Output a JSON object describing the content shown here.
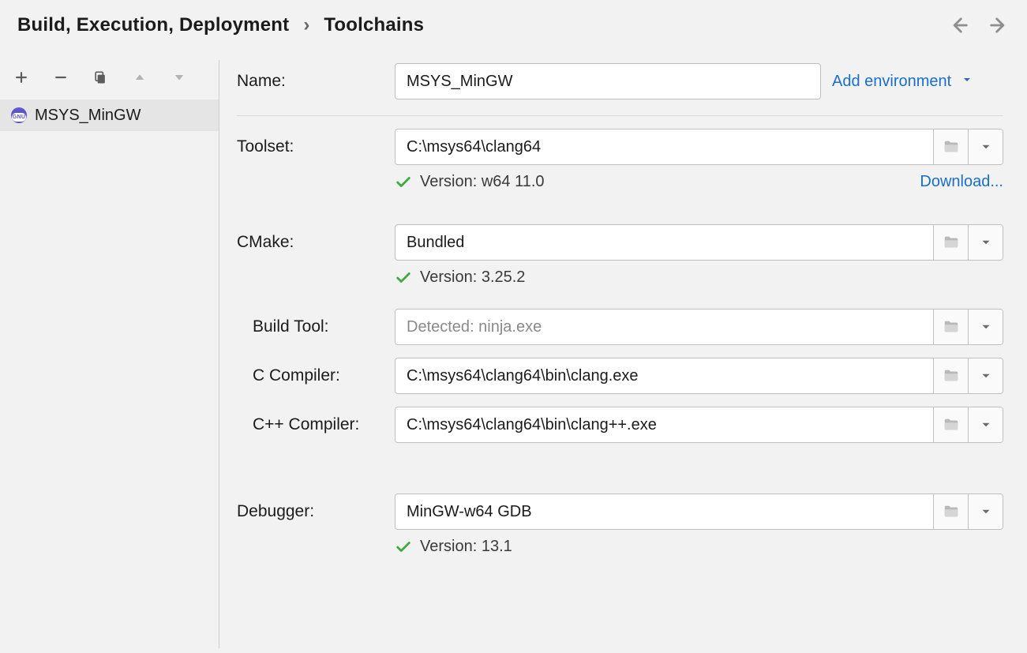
{
  "breadcrumb": {
    "parent": "Build, Execution, Deployment",
    "current": "Toolchains"
  },
  "sidebar": {
    "items": [
      {
        "label": "MSYS_MinGW",
        "selected": true
      }
    ]
  },
  "form": {
    "nameLabel": "Name:",
    "nameValue": "MSYS_MinGW",
    "addEnvLabel": "Add environment",
    "toolsetLabel": "Toolset:",
    "toolsetValue": "C:\\msys64\\clang64",
    "toolsetVersion": "Version: w64 11.0",
    "downloadLabel": "Download...",
    "cmakeLabel": "CMake:",
    "cmakeValue": "Bundled",
    "cmakeVersion": "Version: 3.25.2",
    "buildToolLabel": "Build Tool:",
    "buildToolPlaceholder": "Detected: ninja.exe",
    "cCompilerLabel": "C Compiler:",
    "cCompilerValue": "C:\\msys64\\clang64\\bin\\clang.exe",
    "cxxCompilerLabel": "C++ Compiler:",
    "cxxCompilerValue": "C:\\msys64\\clang64\\bin\\clang++.exe",
    "debuggerLabel": "Debugger:",
    "debuggerValue": "MinGW-w64 GDB",
    "debuggerVersion": "Version: 13.1"
  },
  "gnuBadgeText": "GNU"
}
